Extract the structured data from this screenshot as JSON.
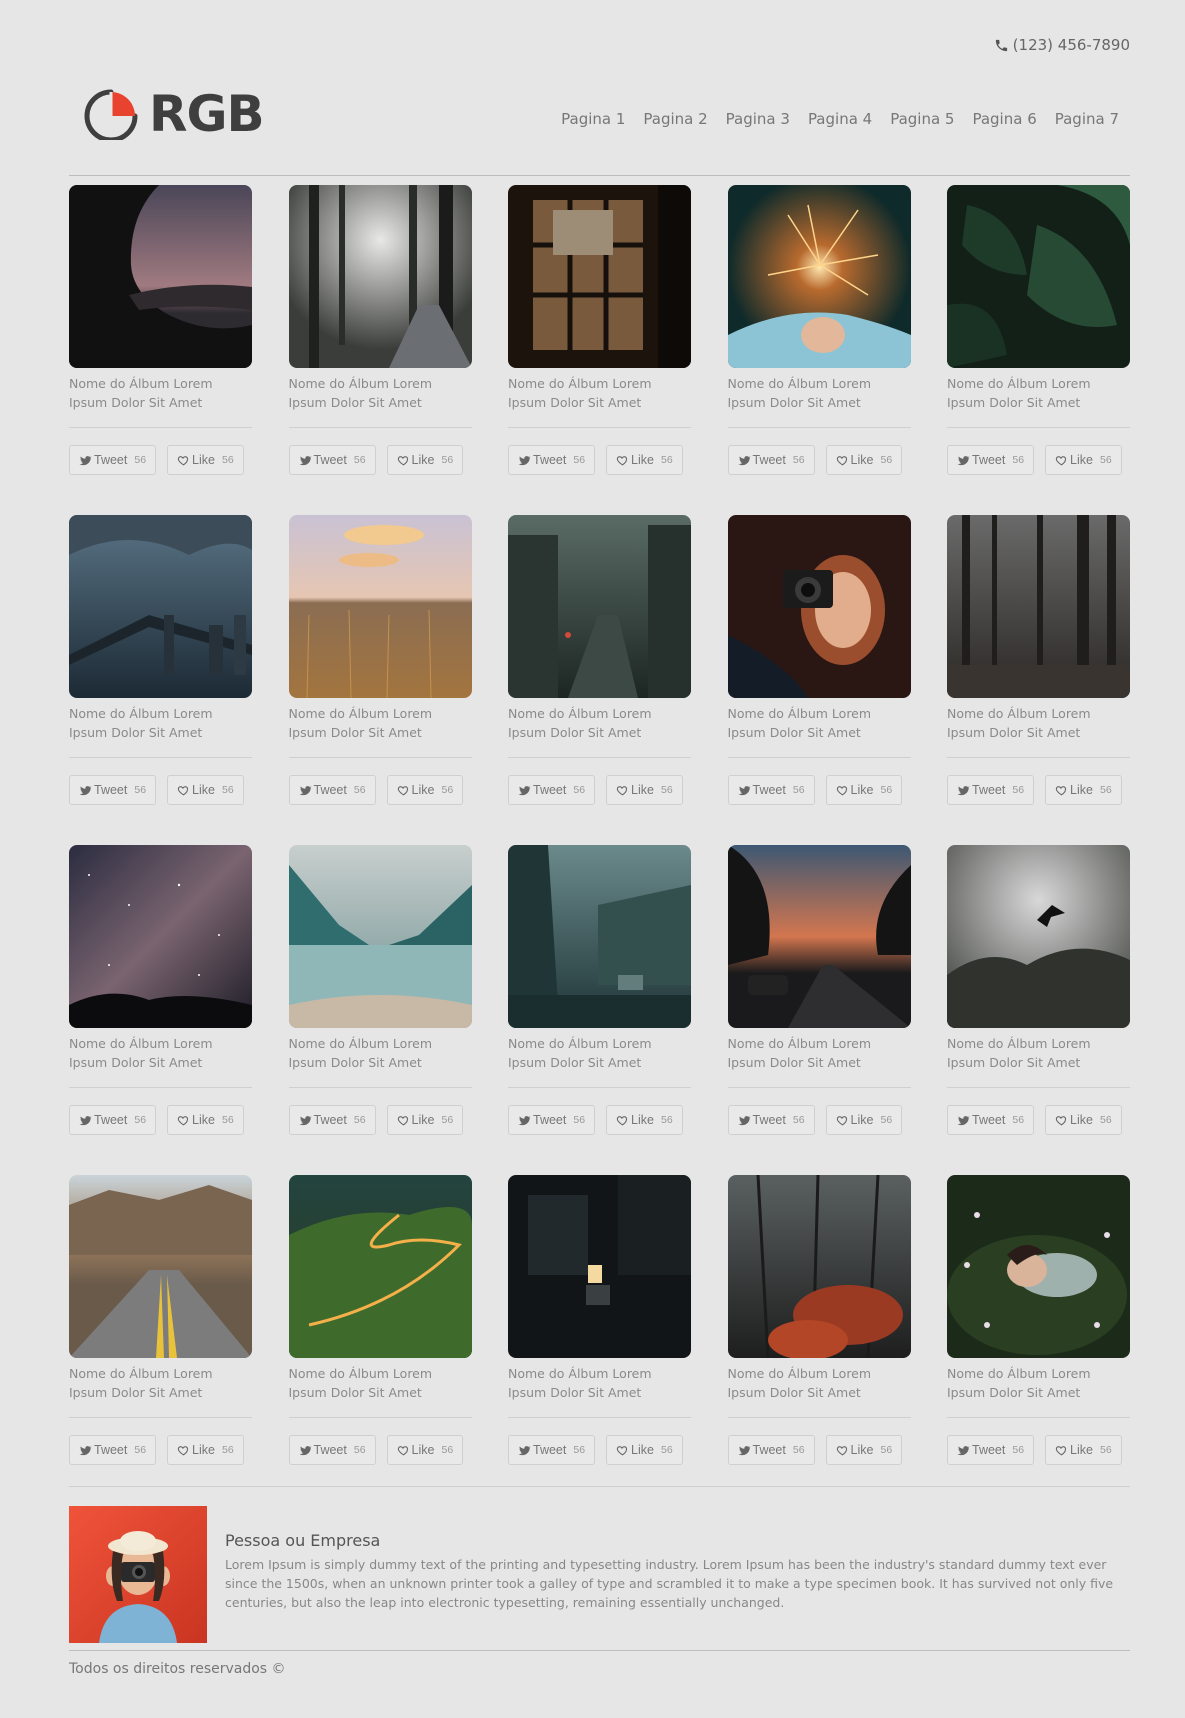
{
  "header": {
    "phone": "(123) 456-7890",
    "logo_text": "RGB",
    "nav": [
      "Pagina 1",
      "Pagina 2",
      "Pagina 3",
      "Pagina 4",
      "Pagina 5",
      "Pagina 6",
      "Pagina 7"
    ]
  },
  "album_caption": "Nome do Álbum Lorem Ipsum Dolor Sit Amet",
  "buttons": {
    "tweet_label": "Tweet",
    "like_label": "Like"
  },
  "albums": [
    {
      "scene": "woman-silhouette-dusk",
      "caption": "Nome do Álbum Lorem Ipsum Dolor Sit Amet",
      "tweets": "56",
      "likes": "56"
    },
    {
      "scene": "misty-forest-path",
      "caption": "Nome do Álbum Lorem Ipsum Dolor Sit Amet",
      "tweets": "56",
      "likes": "56"
    },
    {
      "scene": "window-night",
      "caption": "Nome do Álbum Lorem Ipsum Dolor Sit Amet",
      "tweets": "56",
      "likes": "56"
    },
    {
      "scene": "sparkler",
      "caption": "Nome do Álbum Lorem Ipsum Dolor Sit Amet",
      "tweets": "56",
      "likes": "56"
    },
    {
      "scene": "monstera-leaves",
      "caption": "Nome do Álbum Lorem Ipsum Dolor Sit Amet",
      "tweets": "56",
      "likes": "56"
    },
    {
      "scene": "bridge-city-storm",
      "caption": "Nome do Álbum Lorem Ipsum Dolor Sit Amet",
      "tweets": "56",
      "likes": "56"
    },
    {
      "scene": "wheat-field-sunset",
      "caption": "Nome do Álbum Lorem Ipsum Dolor Sit Amet",
      "tweets": "56",
      "likes": "56"
    },
    {
      "scene": "rainy-street-window",
      "caption": "Nome do Álbum Lorem Ipsum Dolor Sit Amet",
      "tweets": "56",
      "likes": "56"
    },
    {
      "scene": "woman-camera",
      "caption": "Nome do Álbum Lorem Ipsum Dolor Sit Amet",
      "tweets": "56",
      "likes": "56"
    },
    {
      "scene": "dark-pine-forest",
      "caption": "Nome do Álbum Lorem Ipsum Dolor Sit Amet",
      "tweets": "56",
      "likes": "56"
    },
    {
      "scene": "milky-way",
      "caption": "Nome do Álbum Lorem Ipsum Dolor Sit Amet",
      "tweets": "56",
      "likes": "56"
    },
    {
      "scene": "mountain-lake",
      "caption": "Nome do Álbum Lorem Ipsum Dolor Sit Amet",
      "tweets": "56",
      "likes": "56"
    },
    {
      "scene": "foggy-lake-cabin",
      "caption": "Nome do Álbum Lorem Ipsum Dolor Sit Amet",
      "tweets": "56",
      "likes": "56"
    },
    {
      "scene": "road-sunset-trees",
      "caption": "Nome do Álbum Lorem Ipsum Dolor Sit Amet",
      "tweets": "56",
      "likes": "56"
    },
    {
      "scene": "bird-fog",
      "caption": "Nome do Álbum Lorem Ipsum Dolor Sit Amet",
      "tweets": "56",
      "likes": "56"
    },
    {
      "scene": "desert-road",
      "caption": "Nome do Álbum Lorem Ipsum Dolor Sit Amet",
      "tweets": "56",
      "likes": "56"
    },
    {
      "scene": "winding-road-night",
      "caption": "Nome do Álbum Lorem Ipsum Dolor Sit Amet",
      "tweets": "56",
      "likes": "56"
    },
    {
      "scene": "dark-alley-light",
      "caption": "Nome do Álbum Lorem Ipsum Dolor Sit Amet",
      "tweets": "56",
      "likes": "56"
    },
    {
      "scene": "red-autumn-forest",
      "caption": "Nome do Álbum Lorem Ipsum Dolor Sit Amet",
      "tweets": "56",
      "likes": "56"
    },
    {
      "scene": "woman-flowers",
      "caption": "Nome do Álbum Lorem Ipsum Dolor Sit Amet",
      "tweets": "56",
      "likes": "56"
    }
  ],
  "about": {
    "title": "Pessoa ou Empresa",
    "body": "Lorem Ipsum is simply dummy text of the printing and typesetting industry. Lorem Ipsum has been the industry's standard dummy text ever since the 1500s, when an unknown printer took a galley of type and scrambled it to make a type specimen book. It has survived not only five centuries, but also the leap into electronic typesetting, remaining essentially unchanged."
  },
  "footer": {
    "text": "Todos os direitos reservados ©"
  },
  "colors": {
    "background": "#e6e6e6",
    "logo_red": "#e8432e",
    "logo_dark": "#3f3f3f"
  }
}
